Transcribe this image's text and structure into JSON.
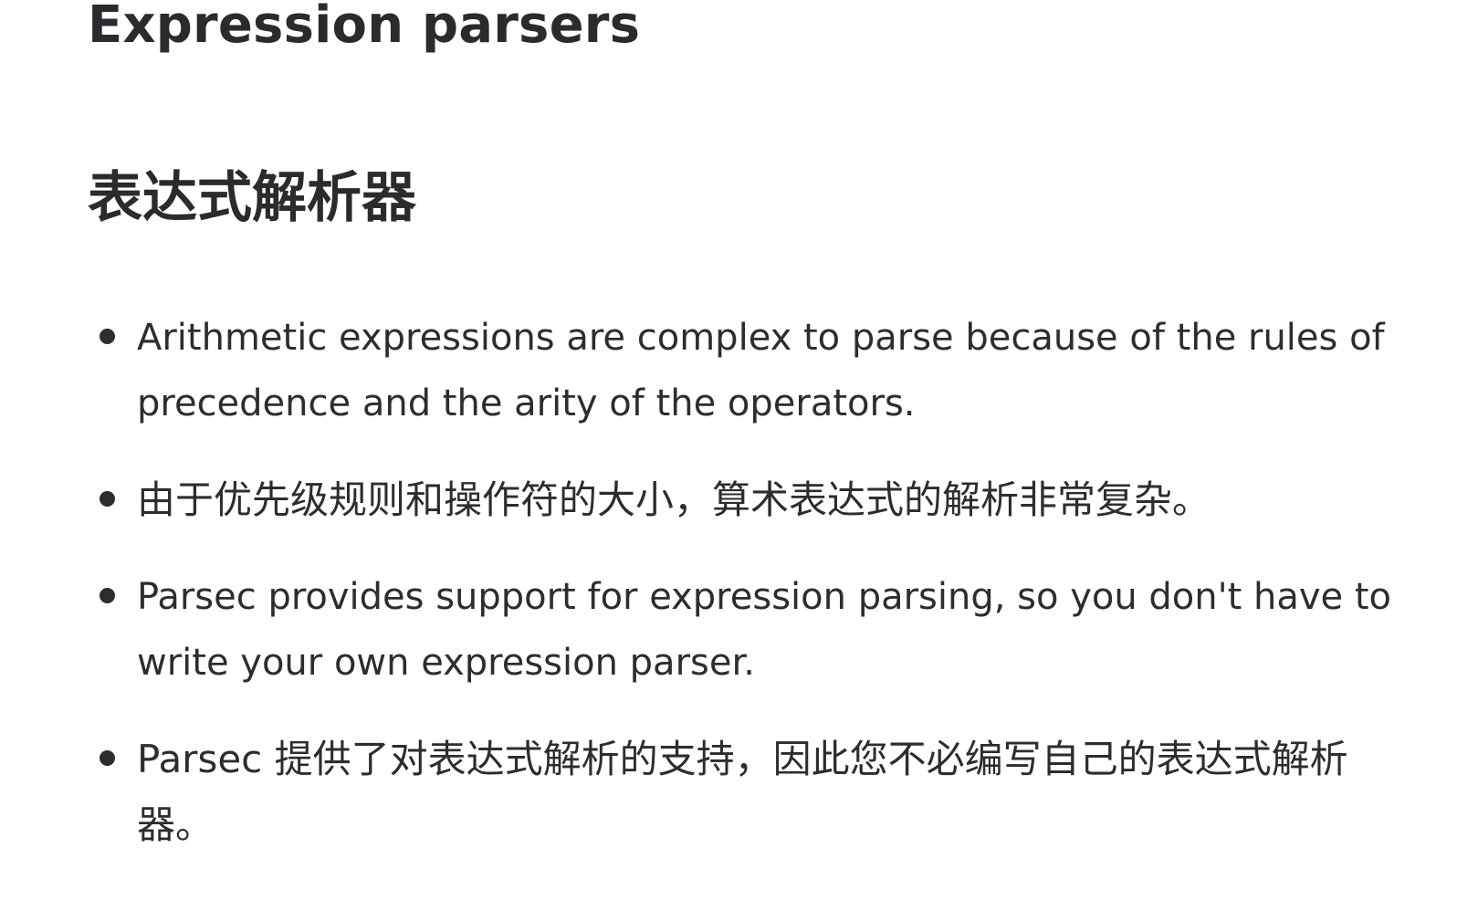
{
  "heading": {
    "english": "Expression parsers",
    "chinese": "表达式解析器"
  },
  "bullets": [
    {
      "text": "Arithmetic expressions are complex to parse because of the rules of precedence and the arity of the operators."
    },
    {
      "text": "由于优先级规则和操作符的大小，算术表达式的解析非常复杂。"
    },
    {
      "text": "Parsec provides support for expression parsing, so you don't have to write your own expression parser."
    },
    {
      "text": "Parsec 提供了对表达式解析的支持，因此您不必编写自己的表达式解析器。"
    }
  ]
}
